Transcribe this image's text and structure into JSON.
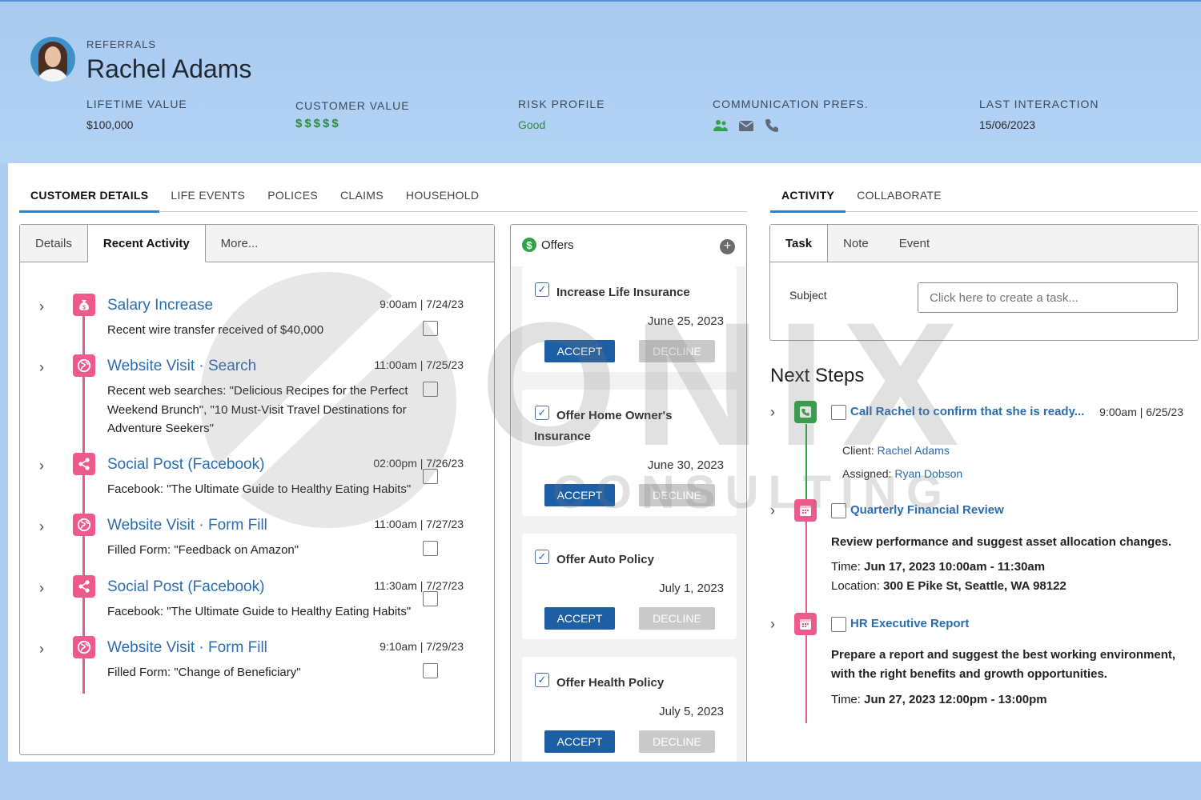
{
  "header": {
    "eyebrow": "REFERRALS",
    "name": "Rachel Adams",
    "metrics": {
      "lifetime_value": {
        "label": "LIFETIME VALUE",
        "value": "$100,000"
      },
      "customer_value": {
        "label": "CUSTOMER VALUE",
        "value": "$$$$$"
      },
      "risk_profile": {
        "label": "RISK PROFILE",
        "value": "Good"
      },
      "communication": {
        "label": "COMMUNICATION PREFS.",
        "icons": [
          "people-icon",
          "mail-icon",
          "phone-icon"
        ]
      },
      "last_interaction": {
        "label": "LAST INTERACTION",
        "value": "15/06/2023"
      }
    }
  },
  "main_tabs": [
    "CUSTOMER DETAILS",
    "LIFE EVENTS",
    "POLICES",
    "CLAIMS",
    "HOUSEHOLD"
  ],
  "side_tabs": [
    "ACTIVITY",
    "COLLABORATE"
  ],
  "sub_tabs": [
    "Details",
    "Recent Activity",
    "More..."
  ],
  "activity": [
    {
      "icon": "money-bag-icon",
      "title": "Salary Increase",
      "time": "9:00am | 7/24/23",
      "desc": "Recent wire transfer received of $40,000"
    },
    {
      "icon": "globe-icon",
      "title": "Website Visit · Search",
      "time": "11:00am | 7/25/23",
      "desc": "Recent web searches: \"Delicious Recipes for the Perfect Weekend Brunch\", \"10 Must-Visit Travel Destinations for Adventure Seekers\""
    },
    {
      "icon": "share-icon",
      "title": "Social Post (Facebook)",
      "time": "02:00pm | 7/26/23",
      "desc": "Facebook: \"The Ultimate Guide to Healthy Eating Habits\""
    },
    {
      "icon": "globe-icon",
      "title": "Website Visit · Form Fill",
      "time": "11:00am | 7/27/23",
      "desc": "Filled Form: \"Feedback on Amazon\""
    },
    {
      "icon": "share-icon",
      "title": "Social Post (Facebook)",
      "time": "11:30am | 7/27/23",
      "desc": "Facebook: \"The Ultimate Guide to Healthy Eating Habits\""
    },
    {
      "icon": "globe-icon",
      "title": "Website Visit · Form Fill",
      "time": "9:10am | 7/29/23",
      "desc": "Filled Form: \"Change of Beneficiary\""
    }
  ],
  "offers": {
    "title": "Offers",
    "accept_label": "ACCEPT",
    "decline_label": "DECLINE",
    "items": [
      {
        "name": "Increase Life Insurance",
        "date": "June 25, 2023"
      },
      {
        "name": "Offer Home Owner's Insurance",
        "date": "June 30, 2023"
      },
      {
        "name": "Offer Auto Policy",
        "date": "July 1, 2023"
      },
      {
        "name": "Offer Health Policy",
        "date": "July 5, 2023"
      }
    ]
  },
  "task_tabs": [
    "Task",
    "Note",
    "Event"
  ],
  "subject": {
    "label": "Subject",
    "placeholder": "Click here to create a task..."
  },
  "next_steps": {
    "title": "Next Steps",
    "items": [
      {
        "title": "Call Rachel to confirm that she is ready...",
        "time": "9:00am | 6/25/23",
        "client_label": "Client:",
        "client": "Rachel Adams",
        "assigned_label": "Assigned:",
        "assigned": "Ryan Dobson"
      },
      {
        "title": "Quarterly Financial Review",
        "desc": "Review performance and suggest asset allocation changes.",
        "time_label": "Time:",
        "time_value": "Jun 17, 2023 10:00am - 11:30am",
        "location_label": "Location:",
        "location_value": "300 E Pike St, Seattle, WA 98122"
      },
      {
        "title": "HR Executive Report",
        "desc": "Prepare a report and suggest the best working environment, with the right benefits and growth opportunities.",
        "time_label": "Time:",
        "time_value": "Jun 27, 2023 12:00pm - 13:00pm"
      }
    ]
  },
  "watermark": {
    "main": "ONIX",
    "sub": "CONSULTING"
  },
  "colors": {
    "accent": "#2f7fd3",
    "event_pink": "#ef5a8c",
    "green": "#2fa447",
    "accept_blue": "#1d5fa5"
  }
}
